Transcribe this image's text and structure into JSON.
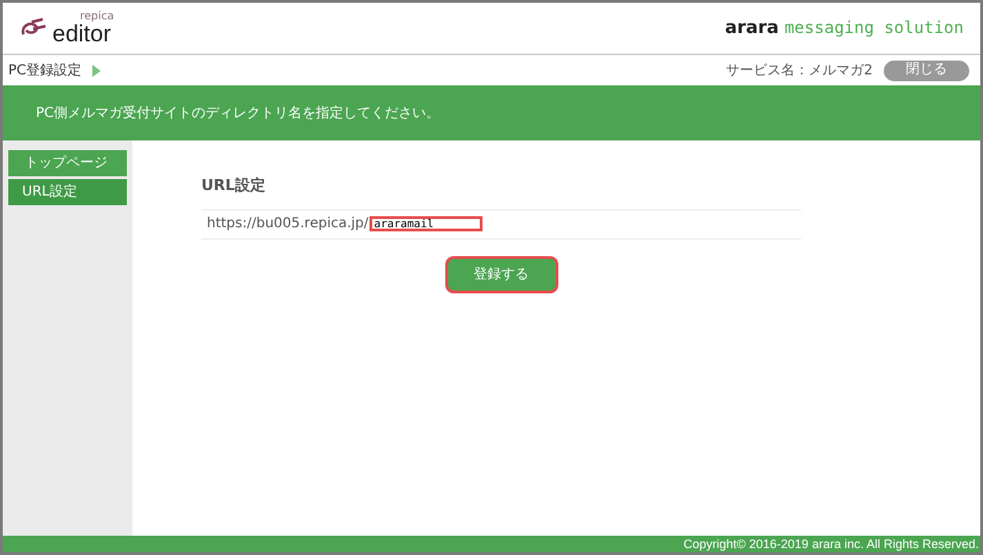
{
  "logo": {
    "small": "repica",
    "main": "editor"
  },
  "brand": {
    "bold": "arara",
    "rest": "messaging solution"
  },
  "breadcrumb": "PC登録設定",
  "service": "サービス名：メルマガ2",
  "close_button": "閉じる",
  "banner": "PC側メルマガ受付サイトのディレクトリ名を指定してください。",
  "sidebar": {
    "items": [
      {
        "label": "トップページ",
        "selected": false
      },
      {
        "label": "URL設定",
        "selected": true
      }
    ]
  },
  "section_title": "URL設定",
  "url_prefix": "https://bu005.repica.jp/",
  "directory_field": {
    "value": "araramail"
  },
  "submit_button": "登録する",
  "footer": "Copyright© 2016-2019 arara inc. All Rights Reserved."
}
